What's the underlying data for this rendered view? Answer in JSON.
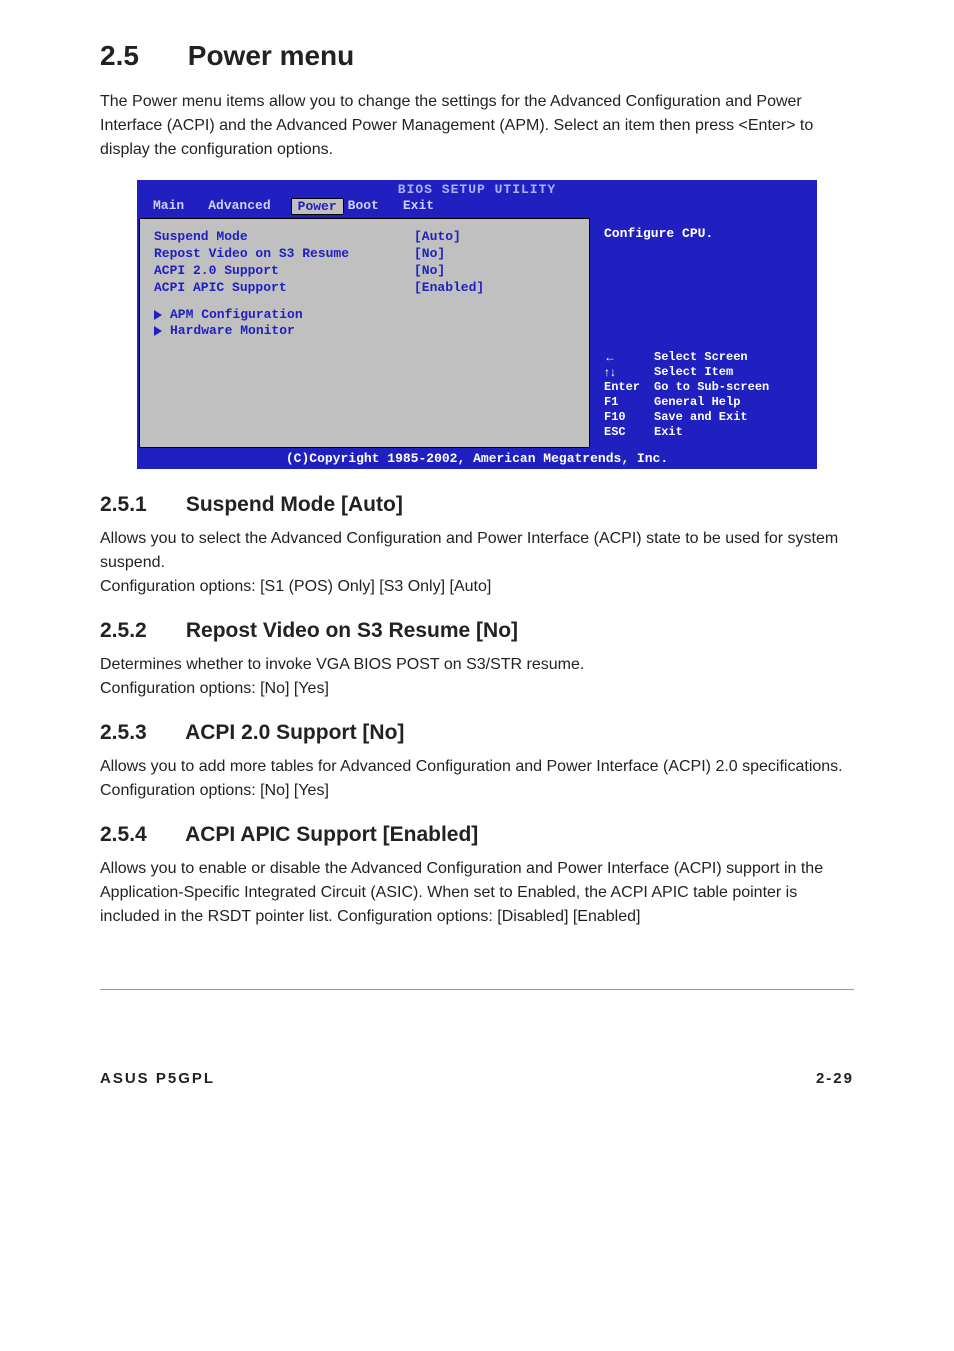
{
  "title": {
    "num": "2.5",
    "text": "Power menu"
  },
  "intro": "The Power menu items allow you to change the settings for the Advanced Configuration and Power Interface (ACPI) and the Advanced Power Management (APM). Select an item then press <Enter> to display the configuration options.",
  "bios": {
    "title": "BIOS SETUP UTILITY",
    "tabs": [
      "Main",
      "Advanced",
      "Power",
      "Boot",
      "Exit"
    ],
    "active_tab": "Power",
    "rows": [
      {
        "label": "Suspend Mode",
        "value": "[Auto]"
      },
      {
        "label": "Repost Video on S3 Resume",
        "value": "[No]"
      },
      {
        "label": "ACPI 2.0 Support",
        "value": "[No]"
      },
      {
        "label": "ACPI APIC Support",
        "value": "[Enabled]"
      }
    ],
    "submenus": [
      "APM Configuration",
      "Hardware Monitor"
    ],
    "hint": "Configure CPU.",
    "keys": [
      {
        "key": "←",
        "desc": "Select Screen"
      },
      {
        "key": "↑↓",
        "desc": "Select Item"
      },
      {
        "key": "Enter",
        "desc": "Go to Sub-screen"
      },
      {
        "key": "F1",
        "desc": "General Help"
      },
      {
        "key": "F10",
        "desc": "Save and Exit"
      },
      {
        "key": "ESC",
        "desc": "Exit"
      }
    ],
    "footer": "(C)Copyright 1985-2002, American Megatrends, Inc."
  },
  "subsections": [
    {
      "num": "2.5.1",
      "title": "Suspend Mode [Auto]",
      "body1": "Allows you to select the Advanced Configuration and Power Interface (ACPI) state to be used for system suspend.",
      "body2": "Configuration options: [S1 (POS) Only] [S3 Only] [Auto]"
    },
    {
      "num": "2.5.2",
      "title": "Repost Video on S3 Resume [No]",
      "body1": "Determines whether to invoke VGA BIOS POST on S3/STR resume.",
      "body2": "Configuration options: [No] [Yes]"
    },
    {
      "num": "2.5.3",
      "title": "ACPI 2.0 Support [No]",
      "body1": "Allows you to add more tables for Advanced Configuration and Power Interface (ACPI) 2.0 specifications. Configuration options: [No] [Yes]",
      "body2": ""
    },
    {
      "num": "2.5.4",
      "title": "ACPI APIC Support [Enabled]",
      "body1": "Allows you to enable or disable the Advanced Configuration and Power Interface (ACPI) support in the Application-Specific Integrated Circuit (ASIC). When set to Enabled, the ACPI APIC table pointer is included in the RSDT pointer list. Configuration options: [Disabled] [Enabled]",
      "body2": ""
    }
  ],
  "footer": {
    "left": "ASUS P5GPL",
    "right": "2-29"
  }
}
